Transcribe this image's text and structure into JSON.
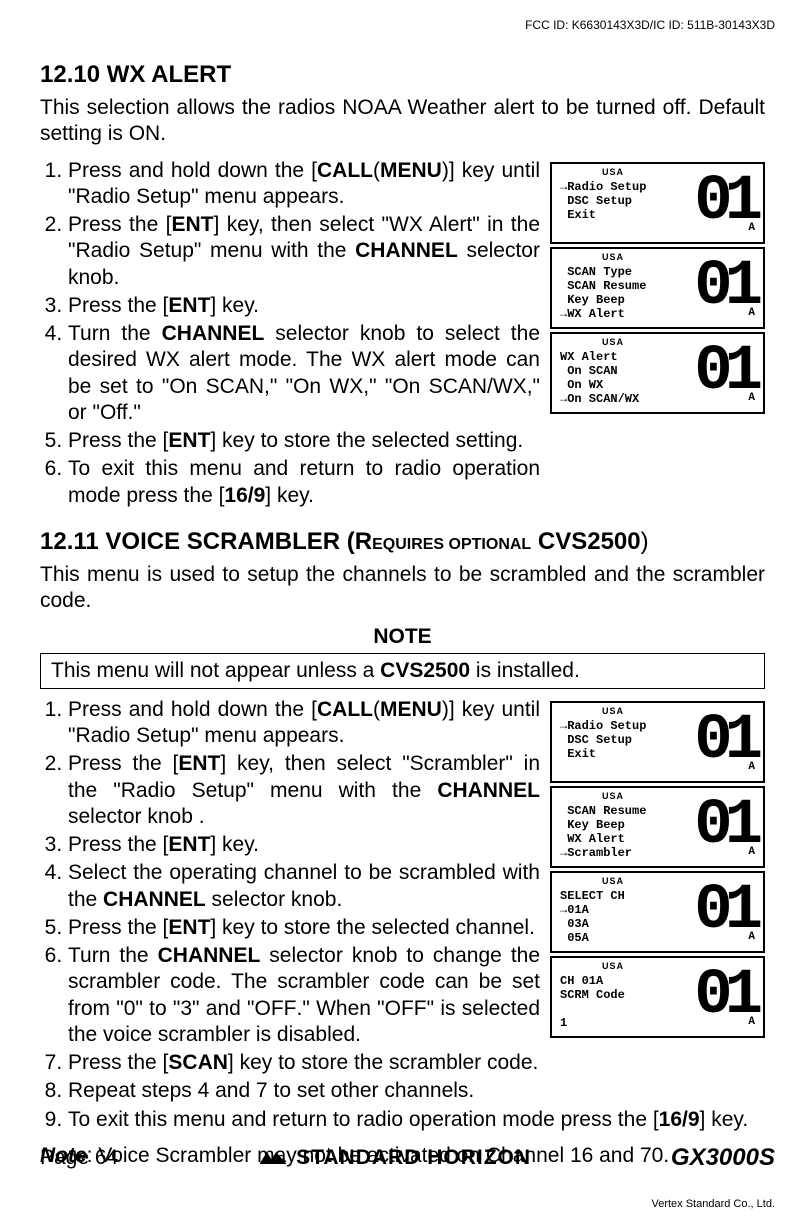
{
  "fcc_id": "FCC ID: K6630143X3D/IC ID: 511B-30143X3D",
  "section_wx": {
    "heading": "12.10  WX ALERT",
    "intro": "This selection allows the radios NOAA Weather alert to be turned off. Default setting is ON.",
    "step1_a": "Press and hold down the [",
    "step1_call": "CALL",
    "step1_paren": "(",
    "step1_menu": "MENU",
    "step1_b": ")] key until \"",
    "step1_rs": "Radio Setup",
    "step1_c": "\" menu appears.",
    "step2_a": "Press the [",
    "step2_ent": "ENT",
    "step2_b": "] key, then select \"",
    "step2_wx": "WX Alert",
    "step2_c": "\" in the \"",
    "step2_rs": "Radio Setup",
    "step2_d": "\" menu with the ",
    "step2_ch": "CHANNEL",
    "step2_e": " selector knob.",
    "step3_a": "Press the [",
    "step3_ent": "ENT",
    "step3_b": "] key.",
    "step4_a": "Turn the ",
    "step4_ch": "CHANNEL",
    "step4_b": " selector knob to select the desired WX alert mode. The WX alert mode can be set to \"",
    "step4_on_scan": "On SCAN",
    "step4_c": ",\" \"",
    "step4_on_wx": "On WX",
    "step4_d": ",\" \"",
    "step4_on_scan_wx": "On SCAN/WX",
    "step4_e": ",\" or \"",
    "step4_off": "Off",
    "step4_f": ".\"",
    "step5_a": "Press the [",
    "step5_ent": "ENT",
    "step5_b": "] key to store the selected setting.",
    "step6_a": "To exit this menu and return to radio operation mode press the [",
    "step6_169": "16/9",
    "step6_b": "] key."
  },
  "lcd_wx": {
    "usa": "USA",
    "big": "01",
    "suffix": "A",
    "l1": "→Radio Setup\n DSC Setup\n Exit",
    "l2": " SCAN Type\n SCAN Resume\n Key Beep\n→WX Alert",
    "l3": "WX Alert\n On SCAN\n On WX\n→On SCAN/WX"
  },
  "section_vs": {
    "heading_a": "12.11  VOICE SCRAMBLER (R",
    "heading_small": "EQUIRES OPTIONAL",
    "heading_b": " CVS2500",
    "heading_c": ")",
    "intro": "This menu is used to setup the channels to be scrambled and the scrambler code.",
    "note_title": "NOTE",
    "note_a": "This menu will not appear unless a ",
    "note_cvs": "CVS2500",
    "note_b": " is installed.",
    "step1_a": "Press and hold down the [",
    "step1_call": "CALL",
    "step1_paren": "(",
    "step1_menu": "MENU",
    "step1_b": ")] key until \"",
    "step1_rs": "Radio Setup",
    "step1_c": "\" menu appears.",
    "step2_a": "Press the [",
    "step2_ent": "ENT",
    "step2_b": "] key, then select \"",
    "step2_scr": "Scrambler",
    "step2_c": "\" in the \"",
    "step2_rs": "Radio Setup",
    "step2_d": "\" menu with the ",
    "step2_ch": "CHANNEL",
    "step2_e": " selector knob .",
    "step3_a": "Press the [",
    "step3_ent": "ENT",
    "step3_b": "] key.",
    "step4_a": "Select the operating channel to be scrambled with the ",
    "step4_ch": "CHANNEL",
    "step4_b": " selector knob.",
    "step5_a": "Press the [",
    "step5_ent": "ENT",
    "step5_b": "] key to store the selected channel.",
    "step6_a": "Turn the ",
    "step6_ch": "CHANNEL",
    "step6_b": " selector knob to change the scrambler code. The scrambler code can be set from \"",
    "step6_0": "0",
    "step6_c": "\" to \"",
    "step6_3": "3",
    "step6_d": "\" and \"",
    "step6_off": "OFF",
    "step6_e": ".\" When \"",
    "step6_off2": "OFF",
    "step6_f": "\" is selected the voice scrambler is disabled.",
    "step7_a": "Press the [",
    "step7_scan": "SCAN",
    "step7_b": "] key to store the scrambler code.",
    "step8": "Repeat steps 4 and 7 to set other channels.",
    "step9_a": "To exit this menu and return to radio operation mode press the [",
    "step9_169": "16/9",
    "step9_b": "] key.",
    "foot_label": "Note",
    "foot_text": ": Voice Scrambler may not be activated on Channel 16 and 70."
  },
  "lcd_vs": {
    "usa": "USA",
    "big": "01",
    "suffix": "A",
    "l1": "→Radio Setup\n DSC Setup\n Exit",
    "l2": " SCAN Resume\n Key Beep\n WX Alert\n→Scrambler",
    "l3": "SELECT CH\n→01A\n 03A\n 05A",
    "l4": "CH 01A\nSCRM Code\n\n1"
  },
  "footer": {
    "page": "Page 64",
    "brand": "STANDARD HORIZON",
    "model": "GX3000S",
    "copyright": "Vertex Standard Co., Ltd."
  }
}
